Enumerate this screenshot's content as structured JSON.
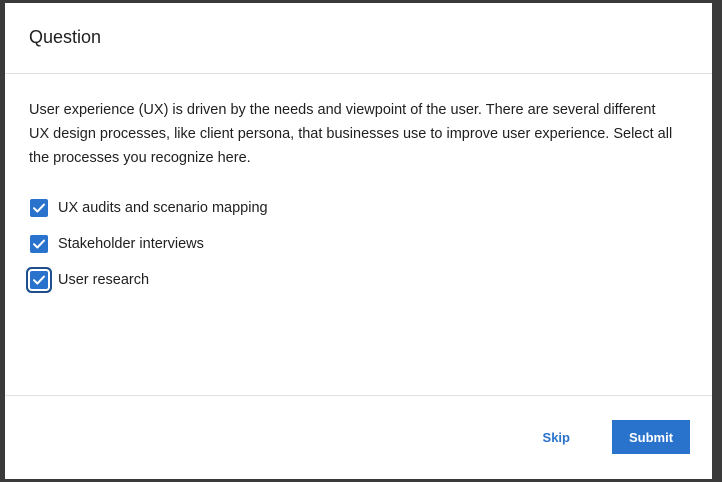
{
  "dialog": {
    "title": "Question",
    "prompt": "User experience (UX) is driven by the needs and viewpoint of the user. There are several different UX design processes, like client persona, that businesses use to improve user experience. Select all the processes you recognize here.",
    "options": [
      {
        "label": "UX audits and scenario mapping",
        "checked": true
      },
      {
        "label": "Stakeholder interviews",
        "checked": true
      },
      {
        "label": "User research",
        "checked": true
      }
    ],
    "skip_label": "Skip",
    "submit_label": "Submit"
  },
  "colors": {
    "accent": "#2a73cc",
    "text": "#1f1f1f",
    "focus_ring": "#1f4f8c"
  },
  "icons": {
    "check": "checkmark-icon"
  }
}
